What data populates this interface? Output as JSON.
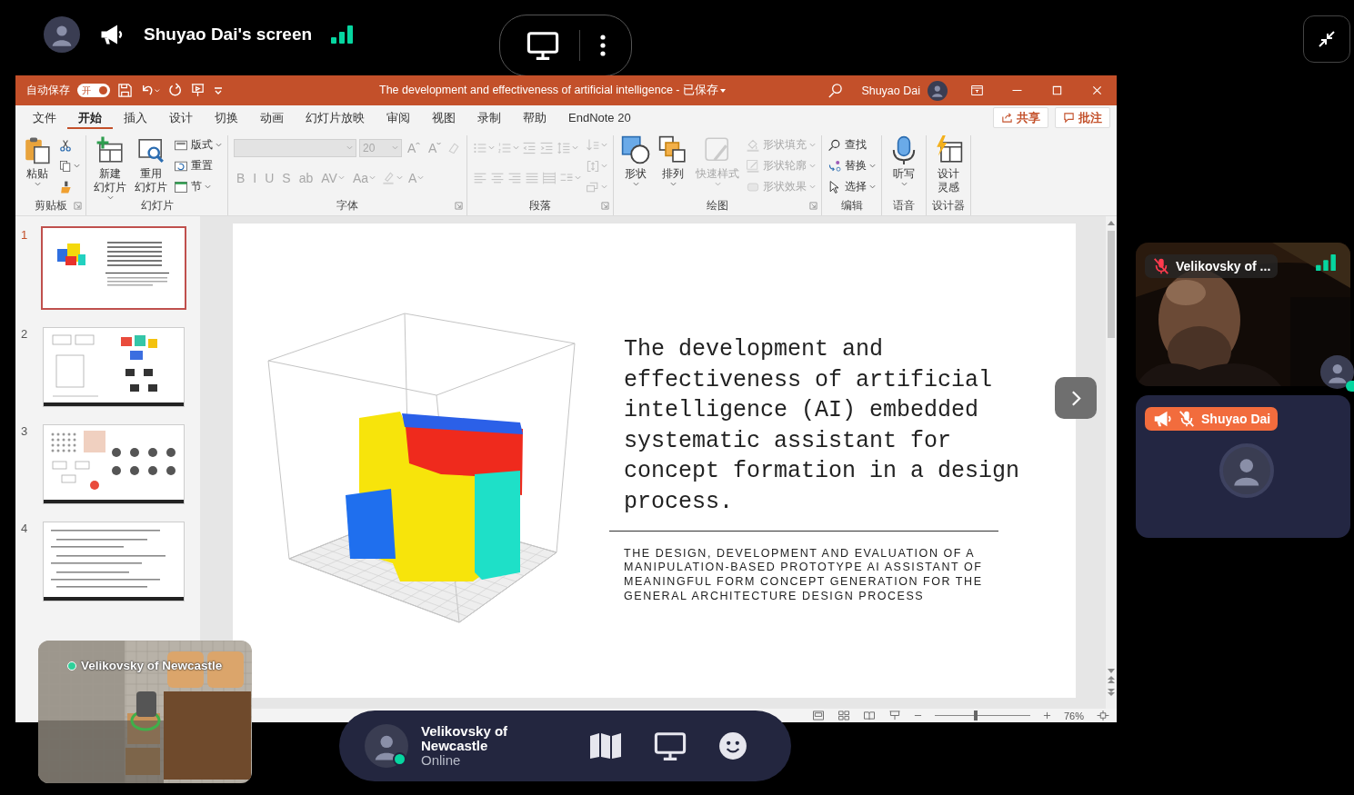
{
  "share_bar": {
    "presenter": "Shuyao Dai's screen"
  },
  "powerpoint": {
    "autosave": {
      "label": "自动保存",
      "toggle": "开",
      "on": true
    },
    "title": "The development and effectiveness of artificial intelligence - 已保存",
    "user": "Shuyao Dai",
    "tabs": [
      {
        "label": "文件",
        "selected": false
      },
      {
        "label": "开始",
        "selected": true
      },
      {
        "label": "插入",
        "selected": false
      },
      {
        "label": "设计",
        "selected": false
      },
      {
        "label": "切换",
        "selected": false
      },
      {
        "label": "动画",
        "selected": false
      },
      {
        "label": "幻灯片放映",
        "selected": false
      },
      {
        "label": "审阅",
        "selected": false
      },
      {
        "label": "视图",
        "selected": false
      },
      {
        "label": "录制",
        "selected": false
      },
      {
        "label": "帮助",
        "selected": false
      },
      {
        "label": "EndNote 20",
        "selected": false
      }
    ],
    "share": "共享",
    "comments": "批注",
    "ribbon": [
      {
        "label": "剪贴板",
        "launcher": true,
        "blocks": [
          {
            "kind": "column",
            "items": [
              {
                "kind": "large",
                "lines": [
                  "粘贴"
                ],
                "caret": true,
                "disabled": false
              }
            ]
          },
          {
            "kind": "column",
            "items": [
              {
                "kind": "tool",
                "caret": false,
                "disabled": false
              },
              {
                "kind": "tool",
                "caret": true,
                "disabled": false
              },
              {
                "kind": "tool",
                "caret": false,
                "disabled": false
              }
            ]
          }
        ]
      },
      {
        "label": "幻灯片",
        "launcher": false,
        "blocks": [
          {
            "kind": "column",
            "items": [
              {
                "kind": "large",
                "lines": [
                  "新建",
                  "幻灯片"
                ],
                "caret": true,
                "disabled": false
              }
            ]
          },
          {
            "kind": "column",
            "items": [
              {
                "kind": "large",
                "lines": [
                  "重用",
                  "幻灯片"
                ],
                "caret": false,
                "disabled": false
              }
            ]
          },
          {
            "kind": "column",
            "items": [
              {
                "kind": "small",
                "label": "版式",
                "caret": true,
                "disabled": false
              },
              {
                "kind": "small",
                "label": "重置",
                "caret": false,
                "disabled": false
              },
              {
                "kind": "small",
                "label": "节",
                "caret": true,
                "disabled": false
              }
            ]
          }
        ]
      },
      {
        "label": "字体",
        "launcher": true,
        "blocks": [
          {
            "kind": "stack",
            "lines": [
              {
                "items": [
                  {
                    "kind": "field",
                    "disabled": true
                  },
                  {
                    "kind": "field",
                    "value": "20",
                    "disabled": true
                  },
                  {
                    "kind": "glyph",
                    "label": "Aˆ",
                    "caret": false,
                    "disabled": true
                  },
                  {
                    "kind": "glyph",
                    "label": "Aˇ",
                    "caret": false,
                    "disabled": true
                  },
                  {
                    "kind": "tool",
                    "caret": false,
                    "disabled": true
                  }
                ]
              },
              {
                "items": [
                  {
                    "kind": "glyph",
                    "label": "B",
                    "caret": false,
                    "disabled": true
                  },
                  {
                    "kind": "glyph",
                    "label": "I",
                    "caret": false,
                    "disabled": true
                  },
                  {
                    "kind": "glyph",
                    "label": "U",
                    "caret": false,
                    "disabled": true
                  },
                  {
                    "kind": "glyph",
                    "label": "S",
                    "caret": false,
                    "disabled": true
                  },
                  {
                    "kind": "glyph",
                    "label": "ab",
                    "caret": false,
                    "disabled": true
                  },
                  {
                    "kind": "glyph",
                    "label": "AV",
                    "caret": true,
                    "disabled": true
                  },
                  {
                    "kind": "glyph",
                    "label": "Aa",
                    "caret": true,
                    "disabled": true
                  },
                  {
                    "kind": "tool",
                    "caret": true,
                    "disabled": true
                  },
                  {
                    "kind": "glyph",
                    "label": "A",
                    "caret": true,
                    "disabled": true
                  }
                ]
              }
            ]
          }
        ]
      },
      {
        "label": "段落",
        "launcher": true,
        "blocks": [
          {
            "kind": "stack",
            "lines": [
              {
                "items": [
                  {
                    "kind": "tool",
                    "caret": true,
                    "disabled": true
                  },
                  {
                    "kind": "tool",
                    "caret": true,
                    "disabled": true
                  },
                  {
                    "kind": "tool",
                    "caret": false,
                    "disabled": true
                  },
                  {
                    "kind": "tool",
                    "caret": false,
                    "disabled": true
                  },
                  {
                    "kind": "tool",
                    "caret": true,
                    "disabled": true
                  }
                ]
              },
              {
                "items": [
                  {
                    "kind": "tool",
                    "caret": false,
                    "disabled": true
                  },
                  {
                    "kind": "tool",
                    "caret": false,
                    "disabled": true
                  },
                  {
                    "kind": "tool",
                    "caret": false,
                    "disabled": true
                  },
                  {
                    "kind": "tool",
                    "caret": false,
                    "disabled": true
                  },
                  {
                    "kind": "tool",
                    "caret": false,
                    "disabled": true
                  },
                  {
                    "kind": "tool",
                    "caret": true,
                    "disabled": true
                  }
                ]
              }
            ]
          },
          {
            "kind": "column",
            "items": [
              {
                "kind": "tool",
                "caret": true,
                "disabled": true
              },
              {
                "kind": "tool",
                "caret": true,
                "disabled": true
              },
              {
                "kind": "tool",
                "caret": true,
                "disabled": true
              }
            ]
          }
        ]
      },
      {
        "label": "绘图",
        "launcher": true,
        "blocks": [
          {
            "kind": "column",
            "items": [
              {
                "kind": "large",
                "lines": [
                  "形状"
                ],
                "caret": true,
                "disabled": false
              }
            ]
          },
          {
            "kind": "column",
            "items": [
              {
                "kind": "large",
                "lines": [
                  "排列"
                ],
                "caret": true,
                "disabled": false
              }
            ]
          },
          {
            "kind": "column",
            "items": [
              {
                "kind": "large",
                "lines": [
                  "快速样式"
                ],
                "caret": true,
                "disabled": true
              }
            ]
          },
          {
            "kind": "column",
            "items": [
              {
                "kind": "small",
                "label": "形状填充",
                "caret": true,
                "disabled": true
              },
              {
                "kind": "small",
                "label": "形状轮廓",
                "caret": true,
                "disabled": true
              },
              {
                "kind": "small",
                "label": "形状效果",
                "caret": true,
                "disabled": true
              }
            ]
          }
        ]
      },
      {
        "label": "编辑",
        "launcher": false,
        "blocks": [
          {
            "kind": "column",
            "items": [
              {
                "kind": "small",
                "label": "查找",
                "caret": false,
                "disabled": false
              },
              {
                "kind": "small",
                "label": "替换",
                "caret": true,
                "disabled": false
              },
              {
                "kind": "small",
                "label": "选择",
                "caret": true,
                "disabled": false
              }
            ]
          }
        ]
      },
      {
        "label": "语音",
        "launcher": false,
        "blocks": [
          {
            "kind": "column",
            "items": [
              {
                "kind": "large",
                "lines": [
                  "听写"
                ],
                "caret": true,
                "disabled": false
              }
            ]
          }
        ]
      },
      {
        "label": "设计器",
        "launcher": false,
        "blocks": [
          {
            "kind": "column",
            "items": [
              {
                "kind": "large",
                "lines": [
                  "设计",
                  "灵感"
                ],
                "caret": false,
                "disabled": false
              }
            ]
          }
        ]
      }
    ],
    "slides": [
      {
        "number": "1",
        "selected": true
      },
      {
        "number": "2",
        "selected": false
      },
      {
        "number": "3",
        "selected": false
      },
      {
        "number": "4",
        "selected": false
      }
    ],
    "slide": {
      "title": "The development and effectiveness of artificial intelligence (AI) embedded systematic assistant for concept formation in a design process.",
      "subtitle": "THE DESIGN, DEVELOPMENT AND EVALUATION OF A MANIPULATION-BASED PROTOTYPE AI ASSISTANT OF MEANINGFUL FORM CONCEPT GENERATION FOR THE GENERAL ARCHITECTURE DESIGN PROCESS"
    },
    "status_bar": {
      "zoom": "76%",
      "level": 0.43
    }
  },
  "participants": [
    {
      "kind": "video",
      "name": "Velikovsky of ...",
      "muted": true,
      "presenting": false
    },
    {
      "kind": "avatar",
      "name": "Shuyao Dai",
      "muted": true,
      "presenting": true
    }
  ],
  "minimap": {
    "label": "Velikovsky of Newcastle"
  },
  "user_bar": {
    "name": "Velikovsky of Newcastle",
    "status": "Online"
  }
}
